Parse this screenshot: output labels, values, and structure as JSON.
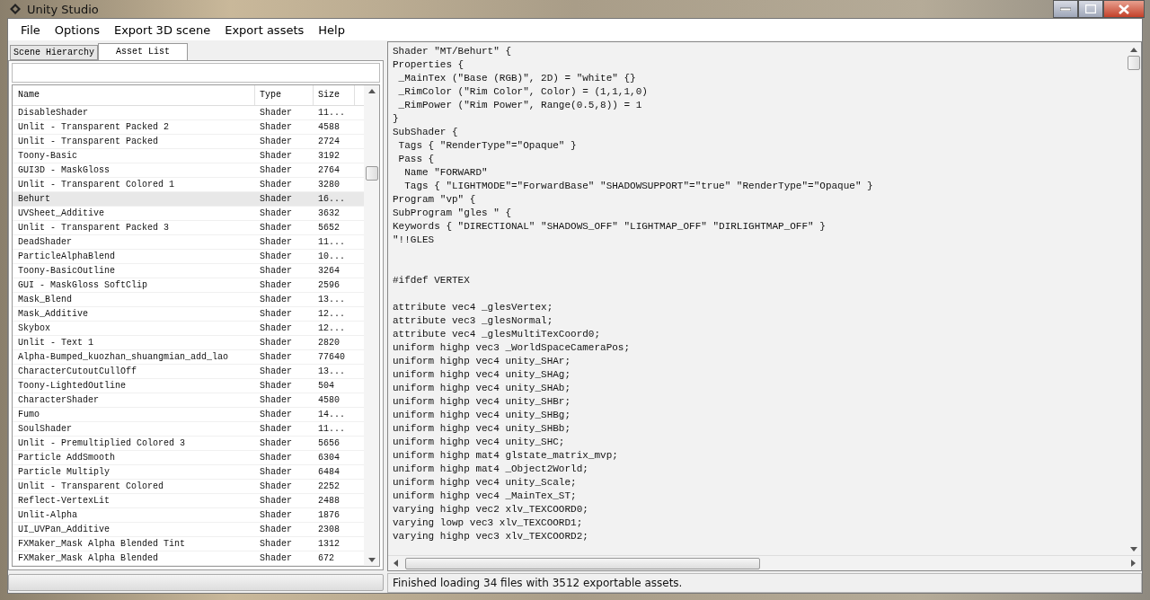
{
  "window": {
    "title": "Unity Studio"
  },
  "menu": [
    "File",
    "Options",
    "Export 3D scene",
    "Export assets",
    "Help"
  ],
  "tabs": [
    {
      "label": "Scene Hierarchy",
      "selected": false
    },
    {
      "label": "Asset List",
      "selected": true
    }
  ],
  "asset_table": {
    "columns": [
      "Name",
      "Type",
      "Size"
    ],
    "rows": [
      {
        "name": "DisableShader",
        "type": "Shader",
        "size": "11...",
        "selected": false
      },
      {
        "name": "Unlit - Transparent Packed 2",
        "type": "Shader",
        "size": "4588",
        "selected": false
      },
      {
        "name": "Unlit - Transparent Packed",
        "type": "Shader",
        "size": "2724",
        "selected": false
      },
      {
        "name": "Toony-Basic",
        "type": "Shader",
        "size": "3192",
        "selected": false
      },
      {
        "name": "GUI3D - MaskGloss",
        "type": "Shader",
        "size": "2764",
        "selected": false
      },
      {
        "name": "Unlit - Transparent Colored 1",
        "type": "Shader",
        "size": "3280",
        "selected": false
      },
      {
        "name": "Behurt",
        "type": "Shader",
        "size": "16...",
        "selected": true
      },
      {
        "name": "UVSheet_Additive",
        "type": "Shader",
        "size": "3632",
        "selected": false
      },
      {
        "name": "Unlit - Transparent Packed 3",
        "type": "Shader",
        "size": "5652",
        "selected": false
      },
      {
        "name": "DeadShader",
        "type": "Shader",
        "size": "11...",
        "selected": false
      },
      {
        "name": "ParticleAlphaBlend",
        "type": "Shader",
        "size": "10...",
        "selected": false
      },
      {
        "name": "Toony-BasicOutline",
        "type": "Shader",
        "size": "3264",
        "selected": false
      },
      {
        "name": "GUI - MaskGloss SoftClip",
        "type": "Shader",
        "size": "2596",
        "selected": false
      },
      {
        "name": "Mask_Blend",
        "type": "Shader",
        "size": "13...",
        "selected": false
      },
      {
        "name": "Mask_Additive",
        "type": "Shader",
        "size": "12...",
        "selected": false
      },
      {
        "name": "Skybox",
        "type": "Shader",
        "size": "12...",
        "selected": false
      },
      {
        "name": "Unlit - Text 1",
        "type": "Shader",
        "size": "2820",
        "selected": false
      },
      {
        "name": "Alpha-Bumped_kuozhan_shuangmian_add_lao",
        "type": "Shader",
        "size": "77640",
        "selected": false
      },
      {
        "name": "CharacterCutoutCullOff",
        "type": "Shader",
        "size": "13...",
        "selected": false
      },
      {
        "name": "Toony-LightedOutline",
        "type": "Shader",
        "size": "504",
        "selected": false
      },
      {
        "name": "CharacterShader",
        "type": "Shader",
        "size": "4580",
        "selected": false
      },
      {
        "name": "Fumo",
        "type": "Shader",
        "size": "14...",
        "selected": false
      },
      {
        "name": "SoulShader",
        "type": "Shader",
        "size": "11...",
        "selected": false
      },
      {
        "name": "Unlit - Premultiplied Colored 3",
        "type": "Shader",
        "size": "5656",
        "selected": false
      },
      {
        "name": "Particle AddSmooth",
        "type": "Shader",
        "size": "6304",
        "selected": false
      },
      {
        "name": "Particle Multiply",
        "type": "Shader",
        "size": "6484",
        "selected": false
      },
      {
        "name": "Unlit - Transparent Colored",
        "type": "Shader",
        "size": "2252",
        "selected": false
      },
      {
        "name": "Reflect-VertexLit",
        "type": "Shader",
        "size": "2488",
        "selected": false
      },
      {
        "name": "Unlit-Alpha",
        "type": "Shader",
        "size": "1876",
        "selected": false
      },
      {
        "name": "UI_UVPan_Additive",
        "type": "Shader",
        "size": "2308",
        "selected": false
      },
      {
        "name": "FXMaker_Mask Alpha Blended Tint",
        "type": "Shader",
        "size": "1312",
        "selected": false
      },
      {
        "name": "FXMaker_Mask Alpha Blended",
        "type": "Shader",
        "size": "672",
        "selected": false
      }
    ]
  },
  "code": "Shader \"MT/Behurt\" {\nProperties {\n _MainTex (\"Base (RGB)\", 2D) = \"white\" {}\n _RimColor (\"Rim Color\", Color) = (1,1,1,0)\n _RimPower (\"Rim Power\", Range(0.5,8)) = 1\n}\nSubShader {\n Tags { \"RenderType\"=\"Opaque\" }\n Pass {\n  Name \"FORWARD\"\n  Tags { \"LIGHTMODE\"=\"ForwardBase\" \"SHADOWSUPPORT\"=\"true\" \"RenderType\"=\"Opaque\" }\nProgram \"vp\" {\nSubProgram \"gles \" {\nKeywords { \"DIRECTIONAL\" \"SHADOWS_OFF\" \"LIGHTMAP_OFF\" \"DIRLIGHTMAP_OFF\" }\n\"!!GLES\n\n\n#ifdef VERTEX\n\nattribute vec4 _glesVertex;\nattribute vec3 _glesNormal;\nattribute vec4 _glesMultiTexCoord0;\nuniform highp vec3 _WorldSpaceCameraPos;\nuniform highp vec4 unity_SHAr;\nuniform highp vec4 unity_SHAg;\nuniform highp vec4 unity_SHAb;\nuniform highp vec4 unity_SHBr;\nuniform highp vec4 unity_SHBg;\nuniform highp vec4 unity_SHBb;\nuniform highp vec4 unity_SHC;\nuniform highp mat4 glstate_matrix_mvp;\nuniform highp mat4 _Object2World;\nuniform highp vec4 unity_Scale;\nuniform highp vec4 _MainTex_ST;\nvarying highp vec2 xlv_TEXCOORD0;\nvarying lowp vec3 xlv_TEXCOORD1;\nvarying highp vec3 xlv_TEXCOORD2;",
  "status_bar": "Finished loading 34 files with 3512 exportable assets."
}
